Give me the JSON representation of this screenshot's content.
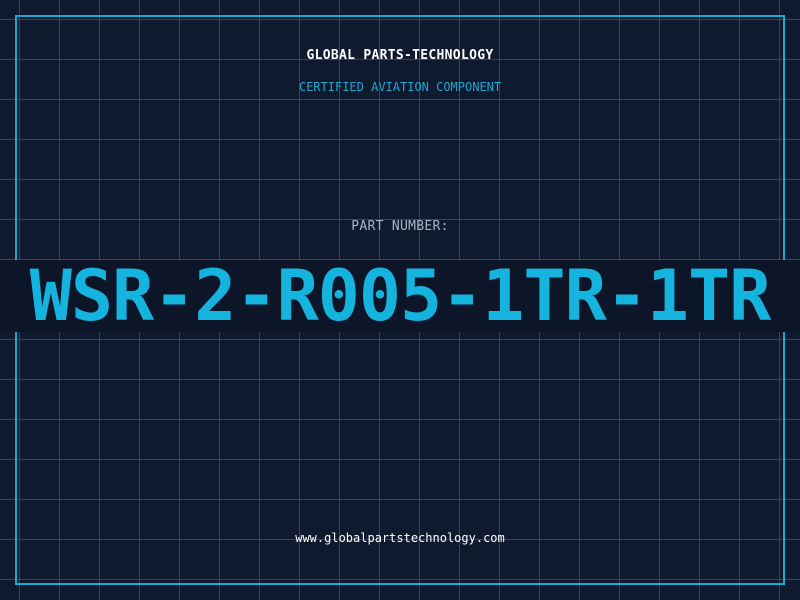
{
  "header": {
    "company": "GLOBAL PARTS-TECHNOLOGY",
    "subtitle": "CERTIFIED AVIATION COMPONENT"
  },
  "part": {
    "label": "PART NUMBER:",
    "number": "WSR-2-R005-1TR-1TR"
  },
  "footer": {
    "website": "www.globalpartstechnology.com"
  },
  "colors": {
    "background": "#101a2e",
    "grid": "#22788f",
    "accent": "#14b4df",
    "text": "#ffffff",
    "label": "#a7b3c4"
  }
}
